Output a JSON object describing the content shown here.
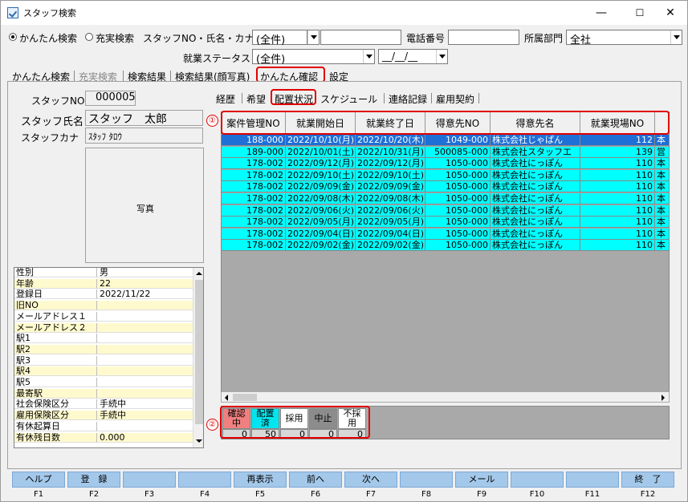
{
  "window": {
    "title": "スタッフ検索",
    "minimize": "—",
    "maximize": "☐",
    "close": "✕"
  },
  "search": {
    "radio_simple": "かんたん検索",
    "radio_full": "充実検索",
    "staff_label": "スタッフNO・氏名・カナ",
    "staff_combo": "(全件)",
    "phone_label": "電話番号",
    "dept_label": "所属部門",
    "dept_combo": "全社",
    "status_label": "就業ステータス",
    "status_combo": "(全件)",
    "date_value": "__/__/__"
  },
  "main_tabs": [
    "かんたん検索",
    "充実検索",
    "検索結果",
    "検索結果(顔写真)",
    "かんたん確認",
    "設定"
  ],
  "staff": {
    "no_label": "スタッフNO",
    "no_value": "000005",
    "name_label": "スタッフ氏名",
    "name_value": "スタッフ　太郎",
    "kana_label": "スタッフカナ",
    "kana_value": "ｽﾀｯﾌ ﾀﾛｳ",
    "photo_label": "写真"
  },
  "props": [
    {
      "k": "性別",
      "v": "男",
      "hl": false
    },
    {
      "k": "年齢",
      "v": "22",
      "hl": true
    },
    {
      "k": "登録日",
      "v": "2022/11/22",
      "hl": false
    },
    {
      "k": "旧NO",
      "v": "",
      "hl": true
    },
    {
      "k": "メールアドレス１",
      "v": "",
      "hl": false
    },
    {
      "k": "メールアドレス２",
      "v": "",
      "hl": true
    },
    {
      "k": "駅1",
      "v": "",
      "hl": false
    },
    {
      "k": "駅2",
      "v": "",
      "hl": true
    },
    {
      "k": "駅3",
      "v": "",
      "hl": false
    },
    {
      "k": "駅4",
      "v": "",
      "hl": true
    },
    {
      "k": "駅5",
      "v": "",
      "hl": false
    },
    {
      "k": "最寄駅",
      "v": "",
      "hl": true
    },
    {
      "k": "社会保険区分",
      "v": "手続中",
      "hl": false
    },
    {
      "k": "雇用保険区分",
      "v": "手続中",
      "hl": true
    },
    {
      "k": "有休起算日",
      "v": "",
      "hl": false
    },
    {
      "k": "有休残日数",
      "v": "0.000",
      "hl": true
    }
  ],
  "sub_tabs": [
    "経歴",
    "希望",
    "配置状況",
    "スケジュール",
    "連絡記録",
    "雇用契約"
  ],
  "grid": {
    "headers": [
      "案件管理NO",
      "就業開始日",
      "就業終了日",
      "得意先NO",
      "得意先名",
      "就業現場NO"
    ],
    "rows": [
      [
        "188-000",
        "2022/10/10(月)",
        "2022/10/20(木)",
        "1049-000",
        "株式会社じゃぱん",
        "112",
        "本"
      ],
      [
        "189-000",
        "2022/10/01(土)",
        "2022/10/31(月)",
        "500085-000",
        "株式会社スタッフエ",
        "139",
        "営"
      ],
      [
        "178-002",
        "2022/09/12(月)",
        "2022/09/12(月)",
        "1050-000",
        "株式会社にっぽん",
        "110",
        "本"
      ],
      [
        "178-002",
        "2022/09/10(土)",
        "2022/09/10(土)",
        "1050-000",
        "株式会社にっぽん",
        "110",
        "本"
      ],
      [
        "178-002",
        "2022/09/09(金)",
        "2022/09/09(金)",
        "1050-000",
        "株式会社にっぽん",
        "110",
        "本"
      ],
      [
        "178-002",
        "2022/09/08(木)",
        "2022/09/08(木)",
        "1050-000",
        "株式会社にっぽん",
        "110",
        "本"
      ],
      [
        "178-002",
        "2022/09/06(火)",
        "2022/09/06(火)",
        "1050-000",
        "株式会社にっぽん",
        "110",
        "本"
      ],
      [
        "178-002",
        "2022/09/05(月)",
        "2022/09/05(月)",
        "1050-000",
        "株式会社にっぽん",
        "110",
        "本"
      ],
      [
        "178-002",
        "2022/09/04(日)",
        "2022/09/04(日)",
        "1050-000",
        "株式会社にっぽん",
        "110",
        "本"
      ],
      [
        "178-002",
        "2022/09/02(金)",
        "2022/09/02(金)",
        "1050-000",
        "株式会社にっぽん",
        "110",
        "本"
      ]
    ]
  },
  "status_legend": [
    {
      "label": "確認\n中",
      "count": "0",
      "color": "#f08080"
    },
    {
      "label": "配置\n済",
      "count": "50",
      "color": "#00e5ee"
    },
    {
      "label": "採用",
      "count": "0",
      "color": "#ffffff"
    },
    {
      "label": "中止",
      "count": "0",
      "color": "#8c8c8c"
    },
    {
      "label": "不採\n用",
      "count": "0",
      "color": "#ffffff"
    }
  ],
  "annotations": [
    "①",
    "②"
  ],
  "fkeys": [
    {
      "label": "ヘルプ",
      "key": "F1"
    },
    {
      "label": "登　録",
      "key": "F2"
    },
    {
      "label": "",
      "key": "F3"
    },
    {
      "label": "",
      "key": "F4"
    },
    {
      "label": "再表示",
      "key": "F5"
    },
    {
      "label": "前へ",
      "key": "F6"
    },
    {
      "label": "次へ",
      "key": "F7"
    },
    {
      "label": "",
      "key": "F8"
    },
    {
      "label": "メール",
      "key": "F9"
    },
    {
      "label": "",
      "key": "F10"
    },
    {
      "label": "",
      "key": "F11"
    },
    {
      "label": "終　了",
      "key": "F12"
    }
  ],
  "colors": {
    "selected_row": "#1e6fd6",
    "row_bg": "#00ffff",
    "highlight_label": "#fffacd",
    "annotation": "#e00000",
    "fkey": "#a3c8ea"
  }
}
